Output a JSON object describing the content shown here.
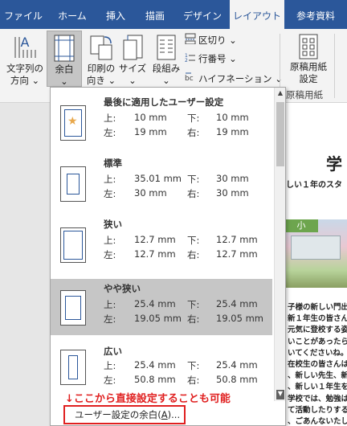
{
  "tabs": [
    "ファイル",
    "ホーム",
    "挿入",
    "描画",
    "デザイン",
    "レイアウト",
    "参考資料"
  ],
  "active_tab": "レイアウト",
  "ribbon": {
    "text_direction": [
      "文字列の",
      "方向 ⌄"
    ],
    "margins": [
      "余白",
      "⌄"
    ],
    "orientation": [
      "印刷の",
      "向き ⌄"
    ],
    "size": [
      "サイズ",
      "⌄"
    ],
    "columns": [
      "段組み",
      "⌄"
    ],
    "breaks": "区切り ⌄",
    "line_numbers": "行番号 ⌄",
    "hyphenation": "ハイフネーション ⌄",
    "genko": [
      "原稿用紙",
      "設定"
    ],
    "genko_group": "原稿用紙"
  },
  "margin_presets": [
    {
      "name": "最後に適用したユーザー設定",
      "top": "10 mm",
      "bottom": "10 mm",
      "left": "19 mm",
      "right": "19 mm",
      "custom": true
    },
    {
      "name": "標準",
      "top": "35.01 mm",
      "bottom": "30 mm",
      "left": "30 mm",
      "right": "30 mm"
    },
    {
      "name": "狭い",
      "top": "12.7 mm",
      "bottom": "12.7 mm",
      "left": "12.7 mm",
      "right": "12.7 mm"
    },
    {
      "name": "やや狭い",
      "top": "25.4 mm",
      "bottom": "25.4 mm",
      "left": "19.05 mm",
      "right": "19.05 mm",
      "highlighted": true
    },
    {
      "name": "広い",
      "top": "25.4 mm",
      "bottom": "25.4 mm",
      "left": "50.8 mm",
      "right": "50.8 mm"
    }
  ],
  "labels": {
    "top": "上:",
    "bottom": "下:",
    "left": "左:",
    "right": "右:"
  },
  "annotation": "↓ここから直接設定することも可能",
  "custom_margins": {
    "text": "ユーザー設定の余白(",
    "accel": "A",
    "suffix": ")..."
  },
  "document": {
    "title": "学",
    "subtitle": "しい１年のスタ",
    "sign": "小",
    "body_lines": [
      "子様の新しい門出",
      "新１年生の皆さん",
      "元気に登校する姿",
      "いことがあったら",
      "いてくださいね。",
      "在校生の皆さんは",
      "、新しい先生、新",
      "、新しい１年生を",
      "学校では、勉強は",
      "て活動したりする",
      "、ごあんないたし"
    ]
  }
}
